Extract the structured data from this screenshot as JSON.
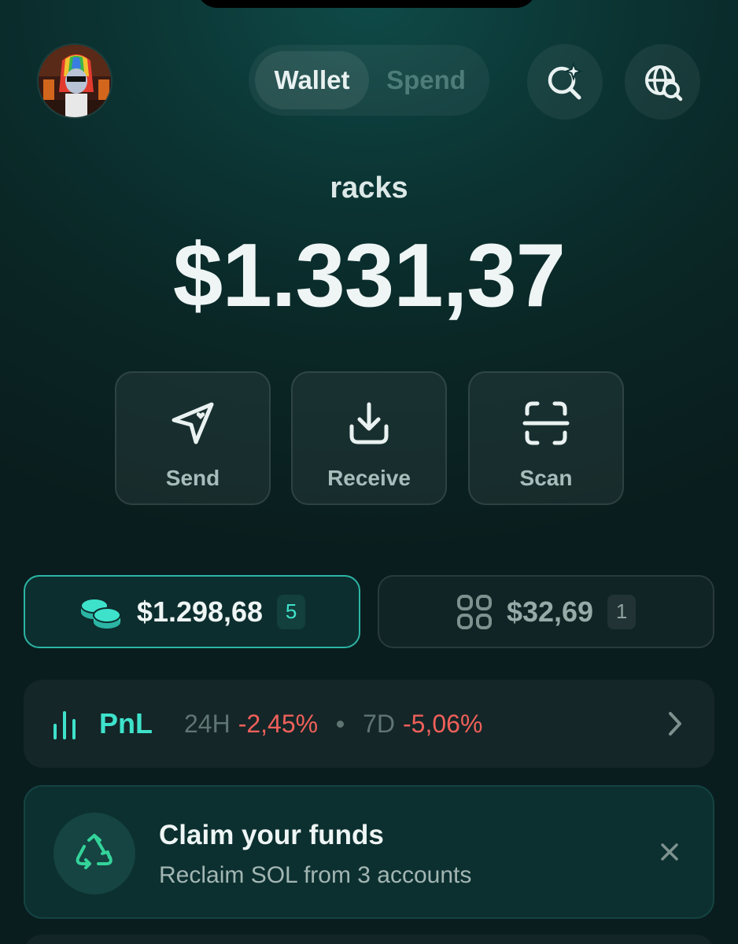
{
  "header": {
    "tabs": [
      {
        "label": "Wallet",
        "active": true
      },
      {
        "label": "Spend",
        "active": false
      }
    ],
    "avatar_icon": "profile-avatar",
    "search_icon": "sparkle-search-icon",
    "explore_icon": "globe-search-icon"
  },
  "account": {
    "name": "racks",
    "balance": "$1.331,37"
  },
  "actions": [
    {
      "label": "Send",
      "icon": "send-icon"
    },
    {
      "label": "Receive",
      "icon": "receive-icon"
    },
    {
      "label": "Scan",
      "icon": "scan-icon"
    }
  ],
  "assets": {
    "tokens": {
      "amount": "$1.298,68",
      "count": "5",
      "icon": "coins-icon"
    },
    "collectibles": {
      "amount": "$32,69",
      "count": "1",
      "icon": "grid-icon"
    }
  },
  "pnl": {
    "title": "PnL",
    "period_24h": "24H",
    "change_24h": "-2,45%",
    "period_7d": "7D",
    "change_7d": "-5,06%"
  },
  "claim": {
    "title": "Claim your funds",
    "subtitle": "Reclaim SOL from 3 accounts",
    "icon": "recycle-icon"
  },
  "colors": {
    "accent": "#3ee2cb",
    "negative": "#f0605a",
    "background": "#0b2a2a"
  }
}
